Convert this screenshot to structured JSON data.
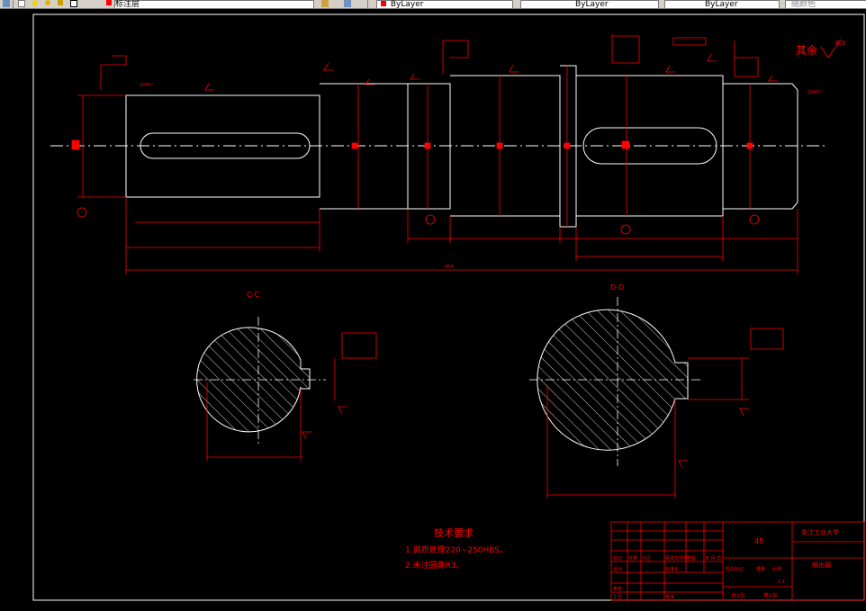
{
  "toolbar": {
    "layer_combo": "标注层",
    "layer_state": "ByLayer",
    "linetype_combo": "ByLayer",
    "lineweight_combo": "ByLayer",
    "plotstyle_combo": "随颜色"
  },
  "drawing": {
    "surface_finish_other": "其余",
    "surface_finish_value": "6.3",
    "tech_req_title": "技术要求",
    "tech_req_1": "1.调质处理220~250HBS。",
    "tech_req_2": "2.未注圆角R3。",
    "section_c_label": "C-C",
    "section_d_label": "D-D",
    "overall_length": "484",
    "chamfer_label": "2X45°",
    "tb_material": "45",
    "tb_school": "浙江工业大学",
    "tb_part_name": "输出轴",
    "tb_sheets_total": "共1张",
    "tb_sheet_no": "第1张",
    "tb_row_mark": "标记",
    "tb_row_qty": "处数",
    "tb_row_zone": "分区",
    "tb_row_doc": "更改文件号",
    "tb_row_sign": "签名",
    "tb_row_date": "年.月.日",
    "tb_design": "设计",
    "tb_std": "标准化",
    "tb_stage": "阶段标记",
    "tb_weight": "重量",
    "tb_scale": "比例",
    "tb_scale_val": "1:1",
    "tb_review": "审核",
    "tb_process": "工艺",
    "tb_approve": "批准"
  }
}
